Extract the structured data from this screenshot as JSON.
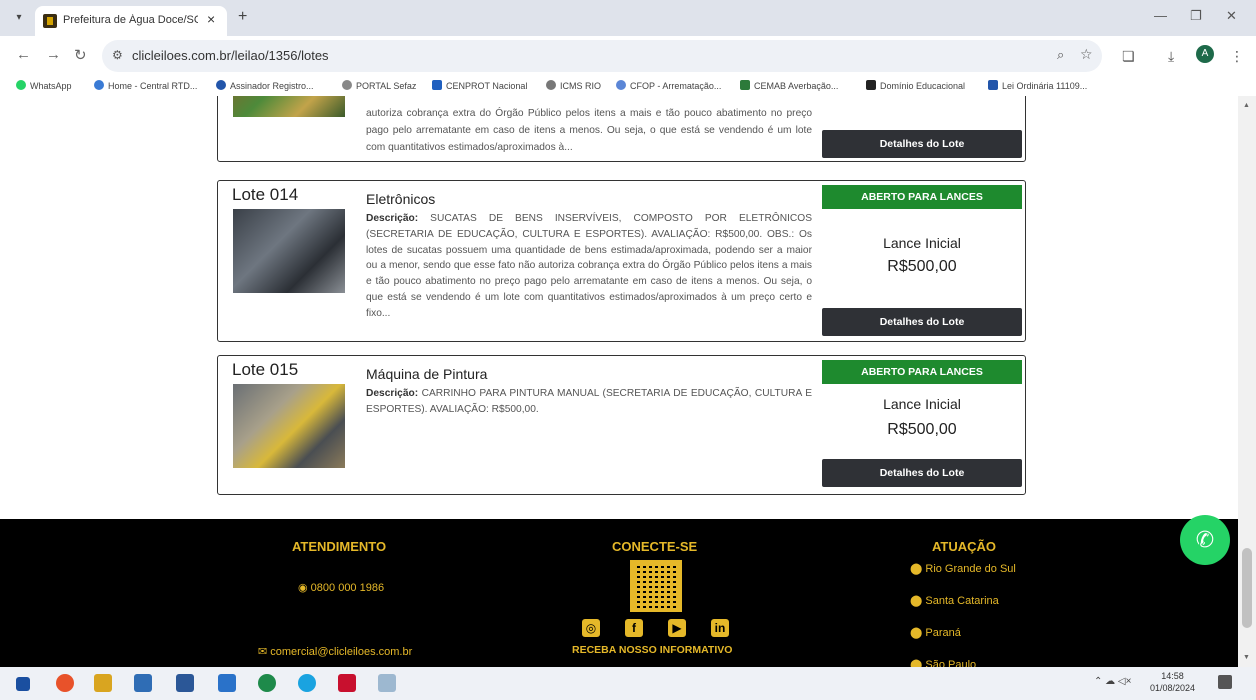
{
  "browser": {
    "tab_title": "Prefeitura de Água Doce/SC :",
    "tab_close": "×",
    "new_tab": "+",
    "url": "clicleiloes.com.br/leilao/1356/lotes",
    "profile_initial": "A",
    "bookmarks": [
      "WhatsApp",
      "Home - Central RTD...",
      "Assinador Registro...",
      "PORTAL Sefaz",
      "CENPROT Nacional",
      "ICMS RIO",
      "CFOP - Arrematação...",
      "CEMAB Averbação...",
      "Domínio Educacional",
      "Lei Ordinária 11109..."
    ]
  },
  "lotes": [
    {
      "desc_rest": "autoriza cobrança extra do Órgão Público pelos itens a mais e tão pouco abatimento no preço pago pelo arrematante em caso de itens a menos. Ou seja, o que está se vendendo é um lote com quantitativos estimados/aproximados à...",
      "details_label": "Detalhes do Lote"
    },
    {
      "number": "Lote 014",
      "title": "Eletrônicos",
      "desc_label": "Descrição:",
      "description": "SUCATAS DE BENS INSERVÍVEIS, COMPOSTO POR ELETRÔNICOS (SECRETARIA DE EDUCAÇÃO, CULTURA E ESPORTES). AVALIAÇÃO: R$500,00. OBS.: Os lotes de sucatas possuem uma quantidade de bens estimada/aproximada, podendo ser a maior ou a menor, sendo que esse fato não autoriza cobrança extra do Órgão Público pelos itens a mais e tão pouco abatimento no preço pago pelo arrematante em caso de itens a menos. Ou seja, o que está se vendendo é um lote com quantitativos estimados/aproximados à um preço certo e fixo...",
      "status": "ABERTO PARA LANCES",
      "lance_label": "Lance Inicial",
      "lance_value": "R$500,00",
      "details_label": "Detalhes do Lote"
    },
    {
      "number": "Lote 015",
      "title": "Máquina de Pintura",
      "desc_label": "Descrição:",
      "description": "CARRINHO PARA PINTURA MANUAL (SECRETARIA DE EDUCAÇÃO, CULTURA E ESPORTES). AVALIAÇÃO: R$500,00.",
      "status": "ABERTO PARA LANCES",
      "lance_label": "Lance Inicial",
      "lance_value": "R$500,00",
      "details_label": "Detalhes do Lote"
    }
  ],
  "footer": {
    "atendimento_title": "ATENDIMENTO",
    "phone": "0800 000 1986",
    "email": "comercial@clicleiloes.com.br",
    "conecte_title": "CONECTE-SE",
    "newsletter": "RECEBA NOSSO INFORMATIVO",
    "atuacao_title": "ATUAÇÃO",
    "states": [
      "Rio Grande do Sul",
      "Santa Catarina",
      "Paraná",
      "São Paulo"
    ]
  },
  "taskbar": {
    "time": "14:58",
    "date": "01/08/2024"
  }
}
